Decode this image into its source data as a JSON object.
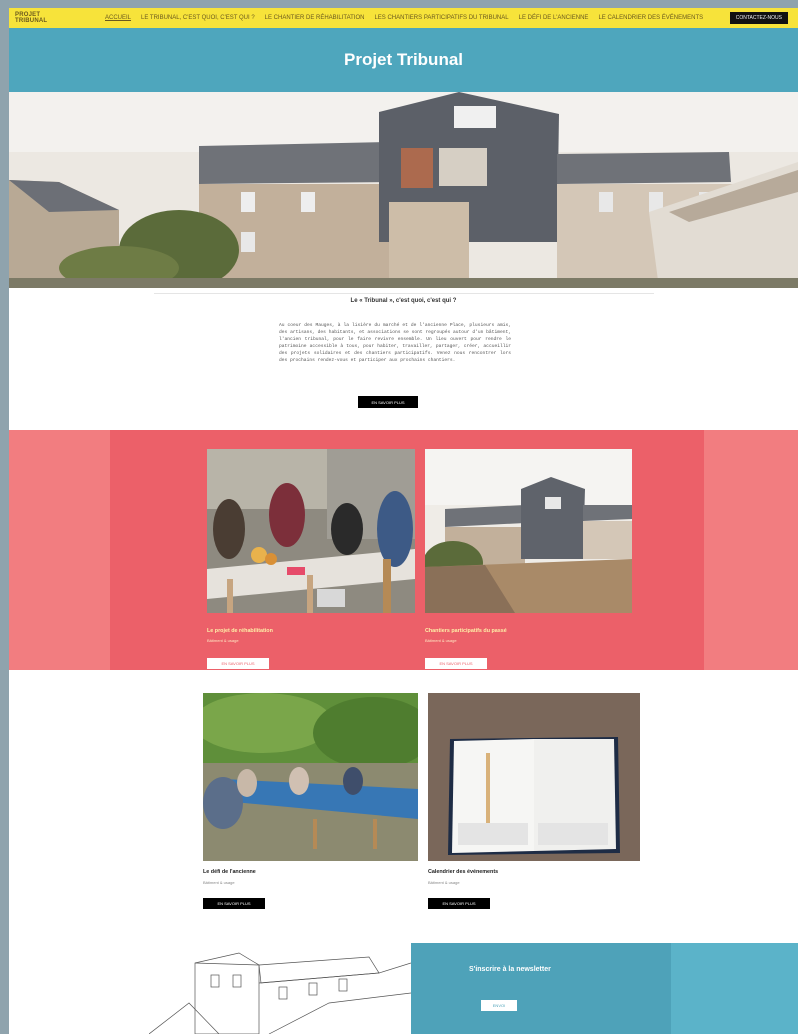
{
  "nav": {
    "brand": "PROJET TRIBUNAL",
    "items": [
      "ACCUEIL",
      "LE TRIBUNAL, C'EST QUOI, C'EST QUI ?",
      "LE CHANTIER DE RÉHABILITATION",
      "LES CHANTIERS PARTICIPATIFS DU TRIBUNAL",
      "LE DÉFI DE L'ANCIENNE",
      "LE CALENDRIER DES ÉVÉNEMENTS"
    ],
    "cta": "CONTACTEZ-NOUS"
  },
  "hero": {
    "title": "Projet Tribunal"
  },
  "intro": {
    "heading": "Le « Tribunal », c'est quoi, c'est qui ?",
    "body": "Au coeur des Mauges, à la lisière du marché et de l'ancienne Place, plusieurs amis, des artisans, des habitants, et associations se sont regroupés autour d'un bâtiment, l'ancien tribunal, pour le faire revivre ensemble. Un lieu ouvert pour rendre le patrimoine accessible à tous, pour habiter, travailler, partager, créer, accueillir des projets solidaires et des chantiers participatifs. Venez nous rencontrer lors des prochains rendez-vous et participer aux prochains chantiers.",
    "button": "EN SAVOIR PLUS"
  },
  "cards_pink": [
    {
      "title": "Le projet de réhabilitation",
      "subtitle": "Bâtiment & usage",
      "button": "EN SAVOIR PLUS"
    },
    {
      "title": "Chantiers participatifs du passé",
      "subtitle": "Bâtiment & usage",
      "button": "EN SAVOIR PLUS"
    }
  ],
  "cards_white": [
    {
      "title": "Le défi de l'ancienne",
      "subtitle": "Bâtiment & usage",
      "button": "EN SAVOIR PLUS"
    },
    {
      "title": "Calendrier des événements",
      "subtitle": "Bâtiment & usage",
      "button": "EN SAVOIR PLUS"
    }
  ],
  "newsletter": {
    "title": "S'inscrire à la newsletter",
    "button": "ENVOI"
  },
  "colors": {
    "nav_bg": "#f7e33a",
    "title_bg": "#4ea6bd",
    "pink": "#ec6069",
    "pink_light": "#f27d80",
    "news_bg": "#4ea2b9"
  }
}
